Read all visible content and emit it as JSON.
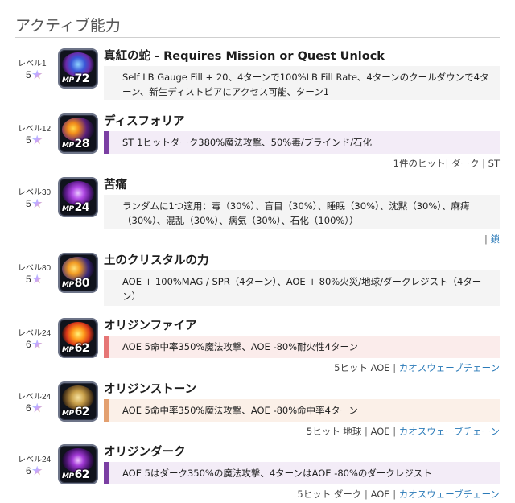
{
  "section_title": "アクティブ能力",
  "abilities": [
    {
      "level": "レベル1",
      "cost": "5",
      "mp": "72",
      "name": "真紅の蛇 - Requires Mission or Quest Unlock",
      "description": "Self LB Gauge Fill + 20、4ターンで100%LB Fill Rate、4ターンのクールダウンで4ターン、新生ディストピアにアクセス可能、ターン1",
      "icon": "crimson-serpent-icon"
    },
    {
      "level": "レベル12",
      "cost": "5",
      "mp": "28",
      "name": "ディスフォリア",
      "description": "ST 1ヒットダーク380%魔法攻撃、50%毒/ブラインド/石化",
      "meta_hits": "1件のヒット",
      "meta_element": "ダーク",
      "meta_target": "ST",
      "icon": "dysphoria-icon"
    },
    {
      "level": "レベル30",
      "cost": "5",
      "mp": "24",
      "name": "苦痛",
      "description": "ランダムに1つ適用：毒（30%）、盲目（30%）、睡眠（30%）、沈黙（30%）、麻痺（30%）、混乱（30%）、病気（30%）、石化（100%））",
      "meta_chain": "鎖",
      "icon": "agony-icon"
    },
    {
      "level": "レベル80",
      "cost": "5",
      "mp": "80",
      "name": "土のクリスタルの力",
      "description": "AOE + 100%MAG / SPR（4ターン）、AOE + 80%火災/地球/ダークレジスト（4ターン）",
      "icon": "earth-crystal-power-icon"
    },
    {
      "level": "レベル24",
      "cost": "6",
      "mp": "62",
      "name": "オリジンファイア",
      "description": "AOE 5命中率350%魔法攻撃、AOE -80%耐火性4ターン",
      "meta_hits": "5ヒット AOE",
      "meta_chain": "カオスウェーブチェーン",
      "icon": "origin-fire-icon"
    },
    {
      "level": "レベル24",
      "cost": "6",
      "mp": "62",
      "name": "オリジンストーン",
      "description": "AOE 5命中率350%魔法攻撃、AOE -80%命中率4ターン",
      "meta_hits": "5ヒット 地球",
      "meta_target": "AOE",
      "meta_chain": "カオスウェーブチェーン",
      "icon": "origin-stone-icon"
    },
    {
      "level": "レベル24",
      "cost": "6",
      "mp": "62",
      "name": "オリジンダーク",
      "description": "AOE 5はダーク350%の魔法攻撃、4ターンはAOE -80%のダークレジスト",
      "meta_hits": "5ヒット ダーク",
      "meta_target": "AOE",
      "meta_chain": "カオスウェーブチェーン",
      "icon": "origin-dark-icon"
    }
  ],
  "colors": {
    "dark_bar": "#7b3fa3",
    "fire_bar": "#e67676",
    "earth_bar": "#e3a070",
    "link": "#2a7ab8"
  }
}
